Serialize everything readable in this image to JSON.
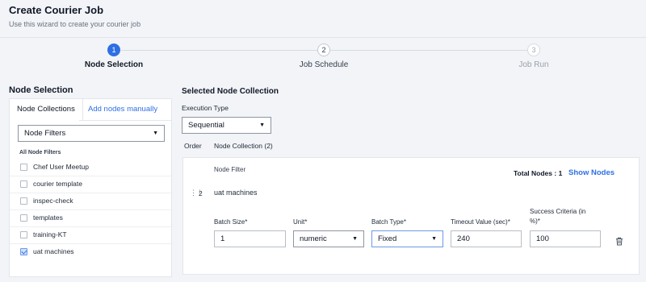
{
  "header": {
    "title": "Create Courier Job",
    "subtitle": "Use this wizard to create your courier job"
  },
  "wizard": {
    "steps": [
      {
        "number": "1",
        "label": "Node Selection",
        "state": "active"
      },
      {
        "number": "2",
        "label": "Job Schedule",
        "state": "pending"
      },
      {
        "number": "3",
        "label": "Job Run",
        "state": "disabled"
      }
    ]
  },
  "left": {
    "title": "Node Selection",
    "tabs": [
      "Node Collections",
      "Add nodes manually"
    ],
    "filter_select": "Node Filters",
    "all_filters_label": "All Node Filters",
    "filters": [
      {
        "label": "Chef User Meetup",
        "checked": false
      },
      {
        "label": "courier template",
        "checked": false
      },
      {
        "label": "inspec-check",
        "checked": false
      },
      {
        "label": "templates",
        "checked": false
      },
      {
        "label": "training-KT",
        "checked": false
      },
      {
        "label": "uat machines",
        "checked": true
      }
    ]
  },
  "right": {
    "title": "Selected Node Collection",
    "execution_type_label": "Execution Type",
    "execution_type": "Sequential",
    "columns": {
      "order": "Order",
      "collection": "Node Collection (2)"
    },
    "card": {
      "node_filter_label": "Node Filter",
      "total_nodes": "Total Nodes : 1",
      "show_nodes": "Show Nodes",
      "order": "2",
      "collection_name": "uat machines",
      "fields": {
        "batch_size": {
          "label": "Batch Size*",
          "value": "1"
        },
        "unit": {
          "label": "Unit*",
          "value": "numeric"
        },
        "batch_type": {
          "label": "Batch Type*",
          "value": "Fixed"
        },
        "timeout": {
          "label": "Timeout Value (sec)*",
          "value": "240"
        },
        "success": {
          "label_line1": "Success Criteria (in",
          "label_line2": "%)*",
          "value": "100"
        }
      }
    }
  },
  "colors": {
    "accent": "#2f6fe4",
    "background": "#f2f4f7"
  }
}
